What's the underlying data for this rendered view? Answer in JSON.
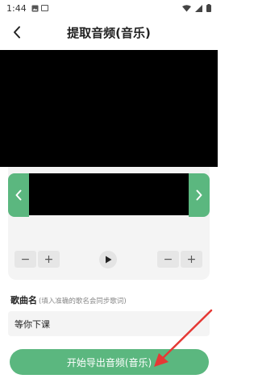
{
  "status_bar": {
    "time": "1:44",
    "icons": [
      "image-icon",
      "square-icon",
      "wifi-icon",
      "signal-icon",
      "battery-icon"
    ]
  },
  "header": {
    "back_icon": "back-chevron-icon",
    "title": "提取音频(音乐)"
  },
  "trim": {
    "left_handle_icon": "chevron-left-icon",
    "right_handle_icon": "chevron-right-icon"
  },
  "controls": {
    "left_stepper": {
      "minus": "−",
      "plus": "+"
    },
    "play_icon": "play-icon",
    "right_stepper": {
      "minus": "−",
      "plus": "+"
    }
  },
  "song": {
    "label": "歌曲名",
    "hint": "(填入准确的歌名会同步歌词)",
    "value": "等你下课"
  },
  "export_button": {
    "label": "开始导出音频(音乐)"
  },
  "colors": {
    "accent": "#5bb77f",
    "annotation": "#e53935",
    "panel": "#f4f4f4"
  }
}
